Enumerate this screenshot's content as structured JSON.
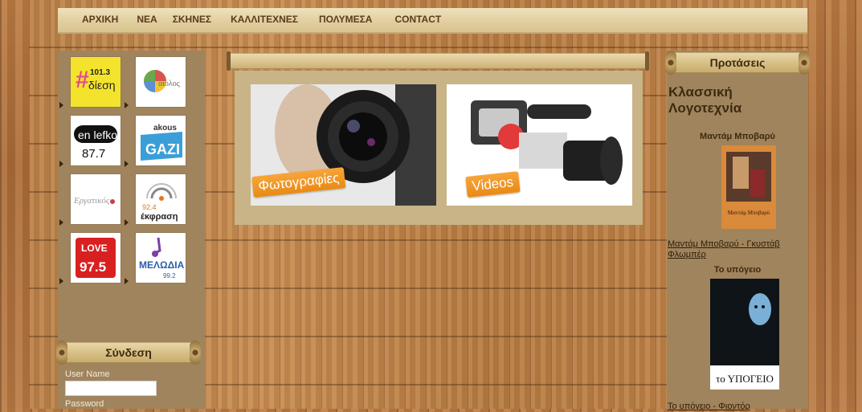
{
  "nav": {
    "items": [
      "ΑΡΧΙΚΗ",
      "ΝΕΑ",
      "ΣΚΗΝΕΣ",
      "ΚΑΛΛΙΤΕΧΝΕΣ",
      "ΠΟΛΥΜΕΣΑ",
      "CONTACT"
    ]
  },
  "radios": [
    {
      "logo_text": "101.3",
      "logo_text2": "δίεση",
      "colors": [
        "#f4e32c",
        "#e64a8e"
      ]
    },
    {
      "logo_text": "αιολος",
      "colors": [
        "#ffffff",
        "#6aa84f"
      ]
    },
    {
      "logo_text": "en lefko",
      "logo_text2": "87.7",
      "colors": [
        "#ffffff",
        "#111111"
      ]
    },
    {
      "logo_text": "akous",
      "logo_text2": "GAZI",
      "colors": [
        "#ffffff",
        "#3a9fd8"
      ]
    },
    {
      "logo_text": "Εργατικός",
      "colors": [
        "#ffffff",
        "#c94040"
      ]
    },
    {
      "logo_text": "92.4",
      "logo_text2": "έκφραση",
      "colors": [
        "#ffffff",
        "#e07a1a"
      ]
    },
    {
      "logo_text": "LOVE",
      "logo_text2": "97.5",
      "colors": [
        "#ffffff",
        "#d92020"
      ]
    },
    {
      "logo_text": "ΜΕΛΩΔΙΑ",
      "logo_text2": "99.2",
      "colors": [
        "#ffffff",
        "#2a5fa8"
      ]
    }
  ],
  "login": {
    "title": "Σύνδεση",
    "username_label": "User Name",
    "password_label": "Password"
  },
  "media": [
    {
      "label": "Φωτογραφίες"
    },
    {
      "label": "Videos"
    }
  ],
  "suggestions": {
    "title": "Προτάσεις",
    "heading": "Κλασσική Λογοτεχνία",
    "books": [
      {
        "title": "Μαντάμ Μποβαρύ",
        "cover_text": "Μαντάμ Μποβαρύ",
        "link": "Μαντάμ Μποβαρύ - Γκυστάβ Φλωμπέρ"
      },
      {
        "title": "Το υπόγειο",
        "cover_text": "το ΥΠΟΓΕΙΟ",
        "link": "Το υπόγειο - Φιοντόρ"
      }
    ]
  }
}
